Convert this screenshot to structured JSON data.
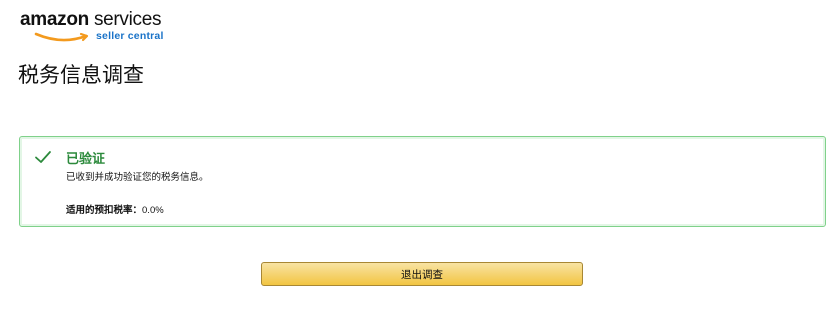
{
  "logo": {
    "brand": "amazon",
    "product": "services",
    "subtitle": "seller central"
  },
  "page": {
    "title": "税务信息调查"
  },
  "alert": {
    "status": "success",
    "heading": "已验证",
    "message": "已收到并成功验证您的税务信息。",
    "rate_label": "适用的预扣税率：",
    "rate_value": "0.0%",
    "icon": "checkmark-icon",
    "accent_color": "#2c8a3c"
  },
  "actions": {
    "exit_label": "退出调查"
  }
}
